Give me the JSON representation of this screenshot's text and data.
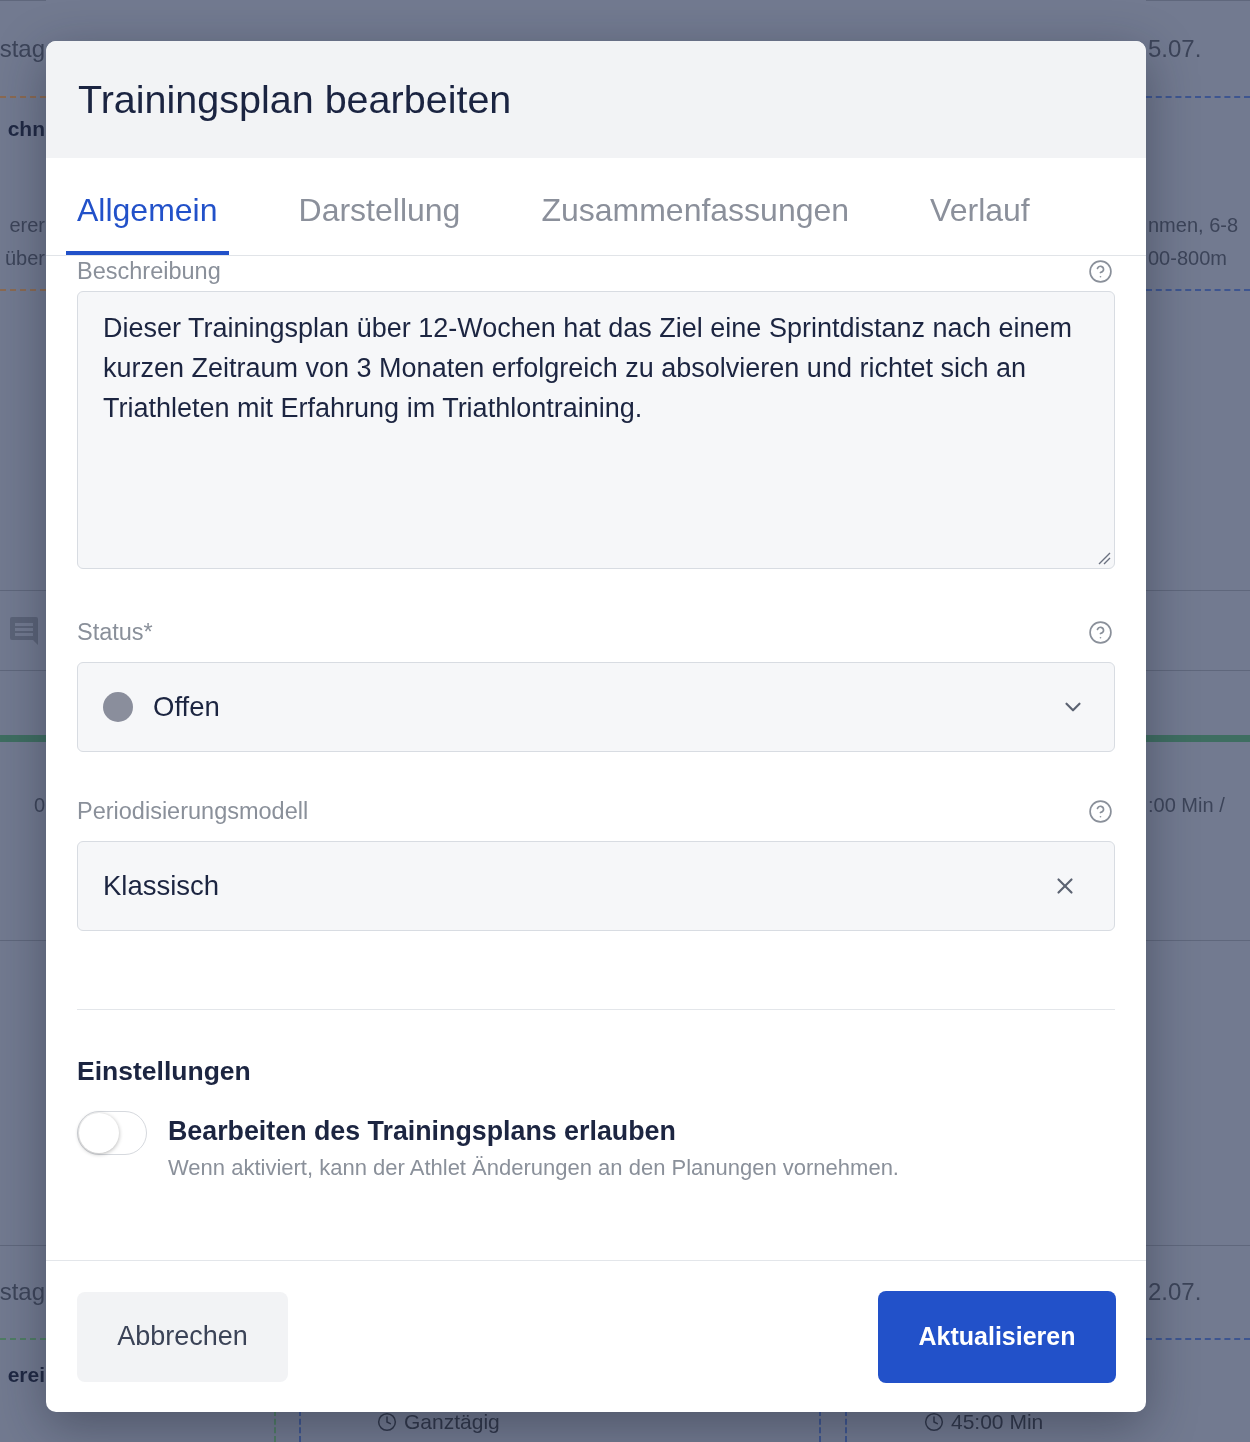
{
  "backdrop": {
    "left": [
      {
        "kind": "date",
        "text": "stag"
      },
      {
        "kind": "title",
        "text": "chn"
      },
      {
        "kind": "detail",
        "text": "erer"
      },
      {
        "kind": "detail",
        "text": "über"
      },
      {
        "kind": "detail",
        "text": "0"
      },
      {
        "kind": "date",
        "text": "stag"
      },
      {
        "kind": "title",
        "text": "erei"
      }
    ],
    "right": [
      {
        "kind": "date",
        "text": "5.07."
      },
      {
        "kind": "detail",
        "text": "nmen, 6-8"
      },
      {
        "kind": "detail",
        "text": "00-800m"
      },
      {
        "kind": "detail",
        "text": ":00 Min /"
      },
      {
        "kind": "date",
        "text": "2.07."
      }
    ],
    "bottom": [
      {
        "kind": "time",
        "text": "Ganztägig"
      },
      {
        "kind": "time",
        "text": "45:00 Min"
      }
    ]
  },
  "dialog": {
    "title": "Trainingsplan bearbeiten",
    "tabs": [
      {
        "label": "Allgemein",
        "selected": true
      },
      {
        "label": "Darstellung",
        "selected": false
      },
      {
        "label": "Zusammenfassungen",
        "selected": false
      },
      {
        "label": "Verlauf",
        "selected": false
      }
    ],
    "fields": [
      {
        "kind": "textarea",
        "label": "Beschreibung",
        "value": "Dieser Trainingsplan über 12-Wochen hat das Ziel eine Sprintdistanz nach einem kurzen Zeitraum von 3 Monaten erfolgreich zu absolvieren und richtet sich an Triathleten mit Erfahrung im Triathlontraining."
      },
      {
        "kind": "select",
        "label": "Status*",
        "value": "Offen",
        "color": "#8a8e9c"
      },
      {
        "kind": "clearable",
        "label": "Periodisierungsmodell",
        "value": "Klassisch"
      }
    ],
    "settings": {
      "heading": "Einstellungen",
      "toggles": [
        {
          "label": "Bearbeiten des Trainingsplans erlauben",
          "description": "Wenn aktiviert, kann der Athlet Änderungen an den Planungen vornehmen.",
          "on": false
        }
      ]
    },
    "buttons": [
      {
        "kind": "secondary",
        "label": "Abbrechen"
      },
      {
        "kind": "primary",
        "label": "Aktualisieren"
      }
    ]
  }
}
